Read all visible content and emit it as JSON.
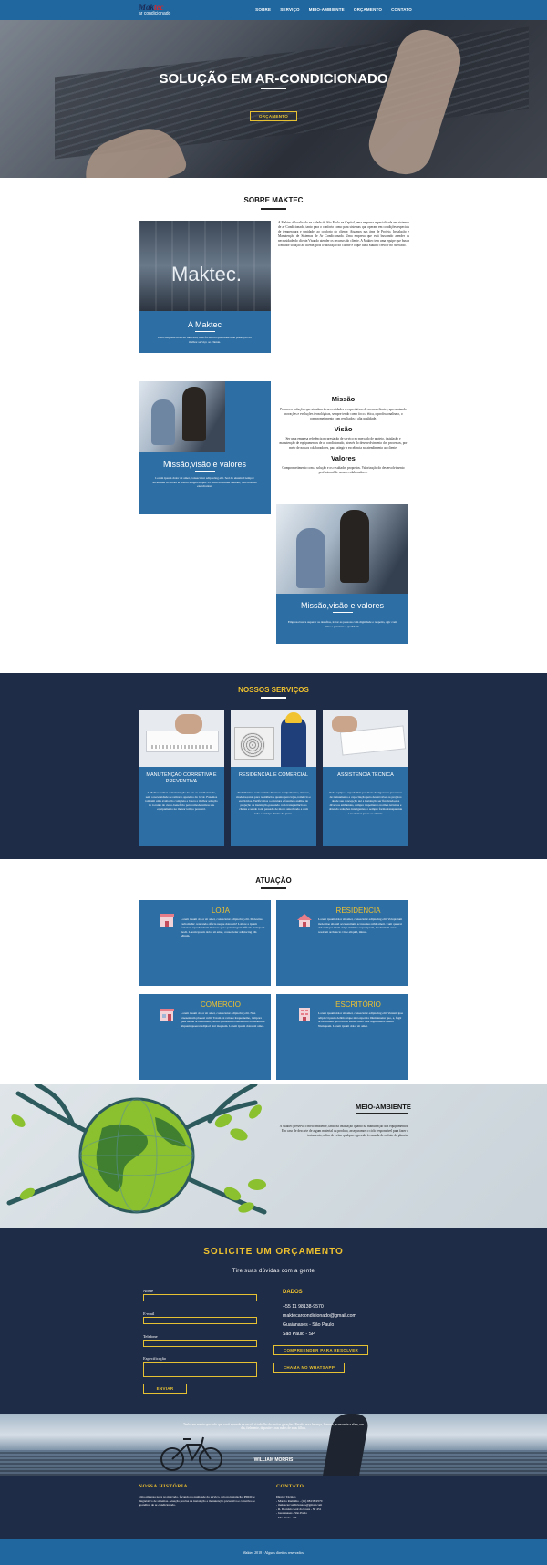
{
  "header": {
    "logo_main": "Mak",
    "logo_accent": "tec",
    "logo_sub": "ar condicionado",
    "nav": [
      "SOBRE",
      "SERVIÇO",
      "MEIO-AMBIENTE",
      "ORÇAMENTO",
      "CONTATO"
    ]
  },
  "hero": {
    "title": "SOLUÇÃO EM AR-CONDICIONADO",
    "button": "ORÇAMENTO"
  },
  "sobre": {
    "title": "SOBRE MAKTEC",
    "photo_sign": "Maktec.",
    "card_title": "A Maktec",
    "card_text": "Uma Empresa nova no mercado, mas focada na qualidade e na prestação do melhor serviço ao cliente.",
    "paragraph": "A Maktec é localizada na cidade de São Paulo na Capital, uma empresa especializada em sistemas de ar Condicionado, tanto para o conforto como para sistemas que operam em condições especiais de temperatura e umidade, ao conforto do cliente. Atuamos nas área de Projeto, Instalação e Manutenção de Sistemas de Ar Condicionado. Uma empresa que está buscando atender as necessidade do cliente.Visando atender os recursos do cliente. A Maktec tem uma equipe que busca a melhor solução ao cliente, pois a satisfação do cliente é o que faz a Maktec crescer no Mercado."
  },
  "mvv": {
    "card_title": "Missão,visão e valores",
    "card_text": "Lorem ipsum dolor sit amet, consectetur adipiscing elit. Sed do eiusmod tempor incididunt ut labore et dolore magna aliqua. Ut enim ad minim veniam, quis nostrud exercitation.",
    "missao_title": "Missão",
    "missao_text": "Promover soluções que atendam às necessidades e expectativas de nossos clientes, apresentando inovações e evoluções tecnológicas, sempre tendo como foco a ética, o profissionalismo, o comprometimento com resultados e alta qualidade.",
    "visao_title": "Visão",
    "visao_text": "Ser uma empresa referência na prestação de serviço no mercado de projeto, instalação e manutenção de equipamentos de ar condicionado, através do desenvolvimento dos processos, por meio de nossos colaboradores, para atingir a excelência no atendimento ao cliente.",
    "valores_title": "Valores",
    "valores_text": "Comprometimento com a solução e os resultados propostos. Valorização do desenvolvimento profissional de nossos colaboradores.",
    "card2_title": "Missão,visão e valores",
    "card2_text": "Empresa busca superar os desafios, tratar as pessoas com dignidade e respeito, agir com ética e priorizar a qualidade."
  },
  "servicos": {
    "title": "NOSSOS SERVIÇOS",
    "items": [
      {
        "name": "MANUTENÇÃO CORRETIVA E PREVENTIVA",
        "text": "A Maktec realiza a manutenção de seu ar-condicionado, sem a necessidade de retirar o aparelho do local. Fazemos também uma avaliação completa e busca a melhor solução no tocante do custo-benefício para remodelarmos seu equipamento no menor tempo possível."
      },
      {
        "name": "RESIDENCIAL E COMERCIAL",
        "text": "Trabalhamos com os mais diversos equipamentos, marcas, modelos,tanto para residências quanto para lojas,comércio e escritórios. Verificamos a estrutura e fazemos análise de projeção da instalação,passando com transparência ao cliente e sendo todo passado de modo antecipado e com todo o serviço dentro do prazo."
      },
      {
        "name": "ASSISTÊNCIA TÉCNICA",
        "text": "Toda equipe é especialista por meio de rigorosos processos de treinamento e capacitação para desenvolver os projetos desde sua concepção até a instalação ser finalizada,nos diversos ambientes, sempre respeitando normas técnicas e obtendo soluções inteligentes, o sempre forma transparente e no menor prazo ao cliente."
      }
    ]
  },
  "atuacao": {
    "title": "ATUAÇÃO",
    "items": [
      {
        "name": "LOJA",
        "text": "Lorem ipsum dolor sit amet, consectetur adipiscing elit. Molestias veritatis hic ceteranda officia neque dolorum? Labore a ipsam facienes, reprehenderit maiores quae quia magni! Officiis numquam modi. Lorem ipsum dolor sit amet, consectetur adipiscing elit. Mirum."
      },
      {
        "name": "RESIDENCIA",
        "text": "Lorem ipsum dolor sit amet, consectetur adipiscing elit. Voluptatum molestiae aliquid accusantium, accusamus nihil ameti. Cum quaerat doloremque illum culpa minima eaque ipsam, laudantium error nostrum architecto vitae aliquid, minus."
      },
      {
        "name": "COMERCIO",
        "text": "Lorem ipsum dolor sit amet, consectetur adipiscing elit. Non praesentium placeat velit! Totam ex ratione itaque nemo, tempora quas neque accusantium, rerum quibusdam laudantium accusantium aliquam quaerat adipisci sint magnam. Lorem ipsum dolor sit amet."
      },
      {
        "name": "ESCRITÓRIO",
        "text": "Lorem ipsum dolor sit amet, consectetur adipiscing elit. Veniam ipsa adipisci ipsum debitis atque nisi expedita illum tenetur quo, a, fugit accusantium quod ullam eleniti iusto ipsa dignissimos omnis. Numquam. Lorem ipsum dolor sit amet."
      }
    ]
  },
  "meio": {
    "title": "MEIO-AMBIENTE",
    "text": "A Maktec preserva o meio ambiente, tanto na instalação quanto na manutenção dos equipamentos. Em caso de descarte de algum material ou produto, asseguramos o ciclo responsável para fazer o tratamento, a fim de evitar qualquer agressão à camada de ozônio do planeta."
  },
  "orcamento": {
    "title": "SOLICITE UM ORÇAMENTO",
    "subtitle": "Tire suas dúvidas com a gente",
    "labels": [
      "Nome",
      "E-mail",
      "Telefone",
      "Especificação"
    ],
    "send": "ENVIAR",
    "dados_title": "DADOS",
    "dados": [
      "+55 11 98138-9570",
      "maktecarcondicionado@gmail.com",
      "Guaianases - São Paulo",
      "São Paulo - SP"
    ],
    "btn1": "COMPREENDER PARA RESOLVER",
    "btn2": "CHAMA NO WHATSAPP"
  },
  "quote": {
    "text": "Tenha em mente que tudo que você aprende na escola é trabalho de muitas gerações. Receba essa herança, honre-a, acrescente a ela e, um dia, fielmente, deposite-a nas mãos de seus filhos.",
    "author": "William Morris"
  },
  "footer": {
    "historia_title": "NOSSA HISTÓRIA",
    "historia_text": "Uma empresa nova no mercado, focando na qualidade do serviço, seja na instalação, PMOC e diagnóstico de sistemas. Atuação precisa na instalação e manutenção preventiva e corretiva de aparelhos de ar-condicionado.",
    "contato_title": "CONTATO",
    "contato": [
      "Diretor Técnico",
      "- Marcio Ramalho - (11) 98138-9570",
      "- maktecarcondicionado@gmail.com",
      "- R. Dionisio Leal da Costa - Nº 451",
      "- Guaianases - São Paulo",
      "- São Paulo - SP"
    ],
    "copyright": "Maktec 2018 - Alguns direitos reservados."
  },
  "colors": {
    "blue": "#2d6ea4",
    "navy": "#1f2c47",
    "gold": "#e6c132",
    "header": "#20679f"
  }
}
